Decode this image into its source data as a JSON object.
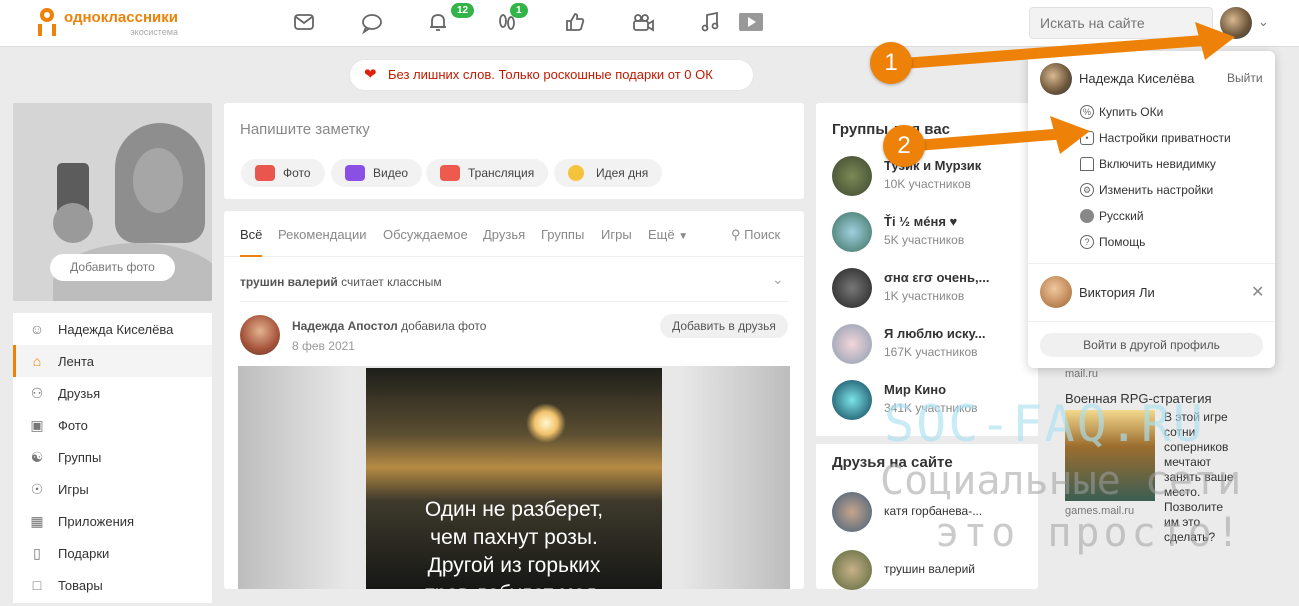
{
  "header": {
    "logo_name": "одноклассники",
    "logo_sub": "экосистема",
    "notifications_badge": "12",
    "guests_badge": "1",
    "search_placeholder": "Искать на сайте"
  },
  "promo": {
    "text": "Без лишних слов. Только роскошные подарки от 0 ОК"
  },
  "profile_photo": {
    "add_label": "Добавить фото"
  },
  "left_menu": [
    {
      "label": "Надежда Киселёва",
      "icon": "user-icon"
    },
    {
      "label": "Лента",
      "icon": "home-icon"
    },
    {
      "label": "Друзья",
      "icon": "friends-icon"
    },
    {
      "label": "Фото",
      "icon": "photo-icon"
    },
    {
      "label": "Группы",
      "icon": "groups-icon"
    },
    {
      "label": "Игры",
      "icon": "games-icon"
    },
    {
      "label": "Приложения",
      "icon": "apps-icon"
    },
    {
      "label": "Подарки",
      "icon": "gift-icon"
    },
    {
      "label": "Товары",
      "icon": "goods-icon"
    }
  ],
  "note": {
    "placeholder": "Напишите заметку",
    "actions": [
      "Фото",
      "Видео",
      "Трансляция",
      "Идея дня"
    ]
  },
  "feed": {
    "tabs": [
      "Всё",
      "Рекомендации",
      "Обсуждаемое",
      "Друзья",
      "Группы",
      "Игры",
      "Ещё"
    ],
    "search_label": "Поиск",
    "activity_name": "трушин валерий",
    "activity_text": "считает классным",
    "post": {
      "author": "Надежда Апостол",
      "action": "добавила фото",
      "date": "8 фев 2021",
      "add_friend": "Добавить в друзья",
      "image_lines": [
        "Один не разберет,",
        "чем пахнут розы.",
        "Другой из горьких",
        "трав добудет мед."
      ]
    }
  },
  "groups": {
    "title": "Группы для вас",
    "items": [
      {
        "name": "Тузик и Мурзик",
        "members": "10K участников"
      },
      {
        "name": "Ťi ½ мéня ♥",
        "members": "5K участников"
      },
      {
        "name": "σнα εгσ οчень,...",
        "members": "1K участников"
      },
      {
        "name": "Я люблю иску...",
        "members": "167K участников"
      },
      {
        "name": "Мир Кино",
        "members": "341K участников"
      }
    ],
    "friends_title": "Друзья на сайте",
    "friends": [
      "катя горбанева-...",
      "трушин валерий"
    ]
  },
  "dropdown": {
    "user_name": "Надежда Киселёва",
    "logout": "Выйти",
    "items": [
      "Купить ОКи",
      "Настройки приватности",
      "Включить невидимку",
      "Изменить настройки",
      "Русский",
      "Помощь"
    ],
    "other_profile": "Виктория Ли",
    "switch_profile": "Войти в другой профиль"
  },
  "ad": {
    "source_top": "mail.ru",
    "title": "Военная RPG-стратегия",
    "text": "В этой игре сотни соперников мечтают занять ваше место. Позволите им это сделать?",
    "source": "games.mail.ru"
  },
  "watermark": {
    "line1": "SOC-FAQ.RU",
    "line2": "Социальные сети",
    "line3": "это просто!"
  },
  "annotations": [
    "1",
    "2"
  ]
}
